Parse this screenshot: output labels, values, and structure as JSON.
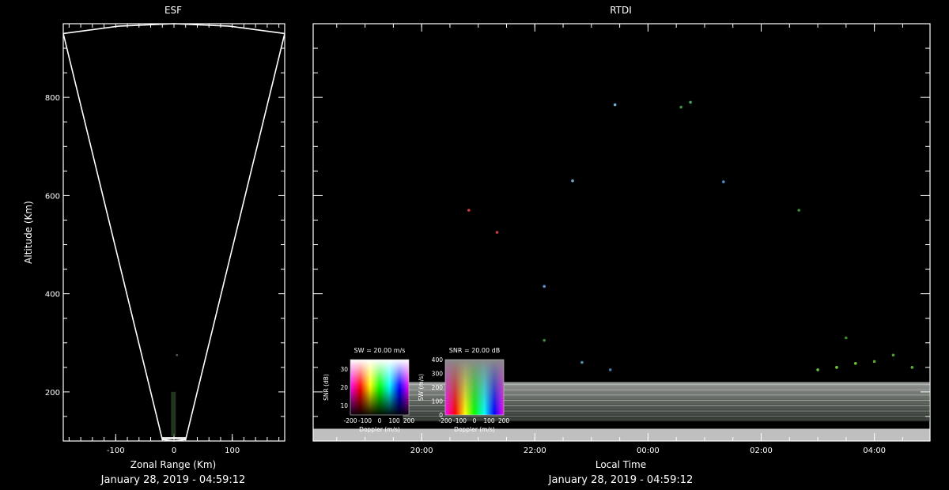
{
  "chart_data": [
    {
      "type": "line",
      "title": "ESF",
      "xlabel": "Zonal Range (Km)",
      "ylabel": "Altitude (Km)",
      "footer": "January 28, 2019 - 04:59:12",
      "xlim": [
        -190,
        190
      ],
      "ylim": [
        100,
        950
      ],
      "xticks": [
        -100,
        0,
        100
      ],
      "yticks": [
        200,
        400,
        600,
        800
      ],
      "grid": false,
      "series": [
        {
          "values": [
            [
              -190,
              930
            ],
            [
              -20,
              103
            ],
            [
              0,
              100
            ],
            [
              20,
              103
            ],
            [
              190,
              930
            ]
          ]
        }
      ],
      "arc": {
        "x": [
          -190,
          -95,
          0,
          95,
          190
        ],
        "y": [
          930,
          945,
          950,
          945,
          930
        ]
      }
    },
    {
      "type": "heatmap",
      "title": "RTDI",
      "xlabel": "Local Time",
      "footer": "January 28, 2019 - 04:59:12",
      "xlim": [
        "18:05",
        "04:59"
      ],
      "ylim": [
        100,
        950
      ],
      "xticks": [
        "20:00",
        "22:00",
        "00:00",
        "02:00",
        "04:00"
      ],
      "grid": false,
      "echo_bands": [
        {
          "start": "19:40",
          "end": "04:59",
          "alt_low": 140,
          "alt_high": 220,
          "color": "#c8cfc8"
        },
        {
          "start": "18:05",
          "end": "04:59",
          "alt_low": 100,
          "alt_high": 125,
          "color": "#ffffff"
        }
      ],
      "scatter_points": [
        {
          "time": "23:25",
          "alt": 785,
          "color": "#6fb5d6"
        },
        {
          "time": "00:35",
          "alt": 780,
          "color": "#3f8f3f"
        },
        {
          "time": "00:45",
          "alt": 790,
          "color": "#4aa66a"
        },
        {
          "time": "22:40",
          "alt": 630,
          "color": "#7aa7c7"
        },
        {
          "time": "01:20",
          "alt": 628,
          "color": "#4b8fd0"
        },
        {
          "time": "20:50",
          "alt": 570,
          "color": "#d43b3b"
        },
        {
          "time": "21:20",
          "alt": 525,
          "color": "#c44040"
        },
        {
          "time": "22:10",
          "alt": 415,
          "color": "#5a8ad0"
        },
        {
          "time": "02:40",
          "alt": 570,
          "color": "#3e8d3e"
        },
        {
          "time": "22:10",
          "alt": 305,
          "color": "#3d8a3d"
        },
        {
          "time": "22:50",
          "alt": 260,
          "color": "#4d8ea8"
        },
        {
          "time": "23:20",
          "alt": 245,
          "color": "#3e7fae"
        },
        {
          "time": "03:00",
          "alt": 245,
          "color": "#64c442"
        },
        {
          "time": "03:20",
          "alt": 250,
          "color": "#70d040"
        },
        {
          "time": "03:40",
          "alt": 258,
          "color": "#6ec43a"
        },
        {
          "time": "04:00",
          "alt": 262,
          "color": "#5fae38"
        },
        {
          "time": "04:20",
          "alt": 275,
          "color": "#4f9a3a"
        },
        {
          "time": "03:30",
          "alt": 310,
          "color": "#3f8a30"
        },
        {
          "time": "04:40",
          "alt": 250,
          "color": "#5cae3c"
        }
      ],
      "colorbars": [
        {
          "title": "SW = 20.00 m/s",
          "xlabel": "Doppler (m/s)",
          "ylabel": "SNR (dB)",
          "xticks": [
            "-200",
            "-100",
            "0",
            "100",
            "200"
          ],
          "yticks": [
            "10",
            "20",
            "30"
          ]
        },
        {
          "title": "SNR = 20.00 dB",
          "xlabel": "Doppler (m/s)",
          "ylabel": "SW (m/s)",
          "xticks": [
            "-200",
            "-100",
            "0",
            "100",
            "200"
          ],
          "yticks": [
            "0",
            "100",
            "200",
            "300",
            "400"
          ]
        }
      ]
    }
  ]
}
